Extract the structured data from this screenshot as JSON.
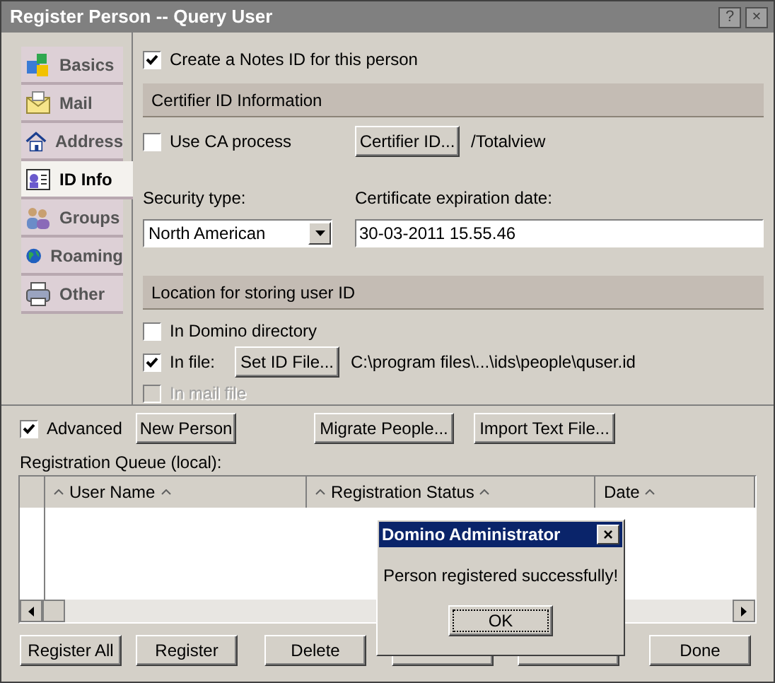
{
  "window": {
    "title": "Register Person -- Query User",
    "help": "?",
    "close": "×"
  },
  "sidebar": {
    "items": [
      {
        "label": "Basics",
        "selected": false
      },
      {
        "label": "Mail",
        "selected": false
      },
      {
        "label": "Address",
        "selected": false
      },
      {
        "label": "ID Info",
        "selected": true
      },
      {
        "label": "Groups",
        "selected": false
      },
      {
        "label": "Roaming",
        "selected": false
      },
      {
        "label": "Other",
        "selected": false
      }
    ]
  },
  "create_id": {
    "label": "Create a Notes ID for this person",
    "checked": true
  },
  "certifier_section": {
    "title": "Certifier ID Information",
    "use_ca": {
      "label": "Use CA process",
      "checked": false
    },
    "button": "Certifier ID...",
    "certifier": "/Totalview"
  },
  "security_type": {
    "label": "Security type:",
    "value": "North American"
  },
  "expiration": {
    "label": "Certificate expiration date:",
    "value": "30-03-2011 15.55.46"
  },
  "location_section": {
    "title": "Location for storing user ID",
    "options": [
      {
        "label": "In Domino directory",
        "checked": false,
        "disabled": false
      },
      {
        "label": "In file:",
        "checked": true,
        "disabled": false,
        "button": "Set ID File...",
        "path": "C:\\program files\\...\\ids\\people\\quser.id"
      },
      {
        "label": "In mail file",
        "checked": false,
        "disabled": true
      }
    ]
  },
  "advanced": {
    "label": "Advanced",
    "checked": true
  },
  "toolbar_buttons": [
    "New Person",
    "Migrate People...",
    "Import Text File..."
  ],
  "queue": {
    "label": "Registration Queue (local):",
    "columns": [
      "User Name",
      "Registration Status",
      "Date"
    ]
  },
  "bottom_buttons": [
    "Register All",
    "Register",
    "Delete",
    "Done"
  ],
  "dialog": {
    "title": "Domino Administrator",
    "close": "×",
    "message": "Person registered successfully!",
    "button": "OK"
  }
}
